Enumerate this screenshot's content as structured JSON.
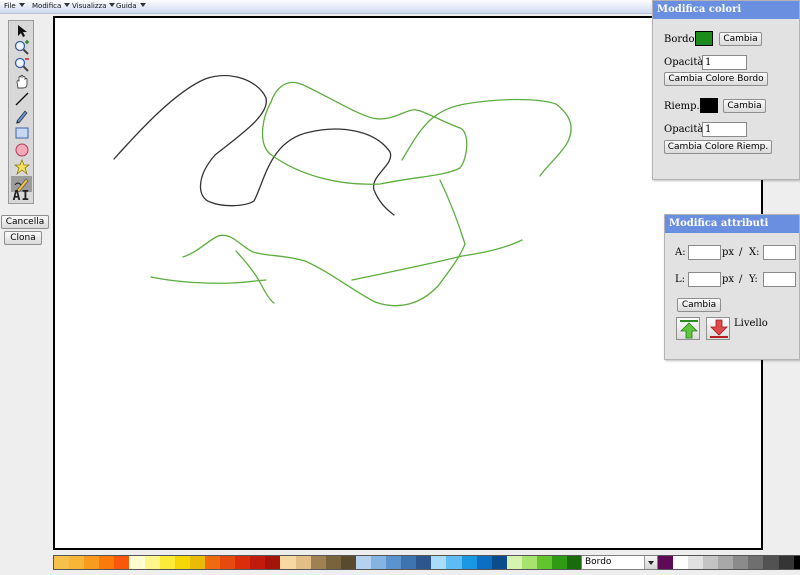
{
  "menu": {
    "items": [
      "File",
      "Modifica",
      "Visualizza",
      "Guida"
    ]
  },
  "toolbox": {
    "tools": [
      "select-arrow-icon",
      "zoom-in-icon",
      "zoom-out-icon",
      "pan-hand-icon",
      "line-icon",
      "pencil-icon",
      "rectangle-icon",
      "ellipse-icon",
      "polygon-star-icon",
      "freehand-icon",
      "text-icon"
    ],
    "active": "freehand-icon",
    "text_tool_label": "AI"
  },
  "actions": {
    "delete_label": "Cancella",
    "clone_label": "Clona"
  },
  "colors_panel": {
    "title": "Modifica colori",
    "border_label": "Bordo:",
    "border_color": "#1d8a1d",
    "change_label": "Cambia",
    "border_opacity_label": "Opacità:",
    "border_opacity_value": "1",
    "change_border_color_label": "Cambia Colore Bordo",
    "fill_label": "Riemp.:",
    "fill_color": "#000000",
    "fill_change_label": "Cambia",
    "fill_opacity_label": "Opacità:",
    "fill_opacity_value": "1",
    "change_fill_color_label": "Cambia Colore Riemp."
  },
  "attributes_panel": {
    "title": "Modifica attributi",
    "a_label": "A:",
    "a_unit": "px",
    "slash1": "/",
    "x_label": "X:",
    "l_label": "L:",
    "l_unit": "px",
    "slash2": "/",
    "y_label": "Y:",
    "change_label": "Cambia",
    "level_label": "Livello"
  },
  "palette": {
    "colors": [
      "#f6c14a",
      "#f7b637",
      "#f99b1f",
      "#fb7a0c",
      "#f9570b",
      "#fefed0",
      "#fef68a",
      "#fdeb3a",
      "#f5d708",
      "#e7bb06",
      "#f06b10",
      "#e64a0f",
      "#d92d0c",
      "#c21b0b",
      "#a31509",
      "#f6d9a2",
      "#e2bd86",
      "#9d8155",
      "#79633d",
      "#5a4a2d",
      "#b4d2ef",
      "#86b4e2",
      "#5b93cc",
      "#3e74b0",
      "#2c568c",
      "#a9dcfa",
      "#5cbdf4",
      "#1a98e4",
      "#0d6fc2",
      "#0a4c8c",
      "#d6f3b0",
      "#a7e36e",
      "#62c52d",
      "#2f9a13",
      "#1a6b0b",
      "#0b4a06",
      "#fcc7e9",
      "#f772d2",
      "#e119b6",
      "#a60f8c",
      "#5e0a57",
      "#ffffff",
      "#e1e1e1",
      "#c4c4c4",
      "#a8a8a8",
      "#8b8b8b",
      "#6f6f6f",
      "#525252",
      "#353535",
      "#000000"
    ],
    "mode_value": "Bordo"
  },
  "canvas": {
    "stroke_colors": {
      "dark": "#333333",
      "green": "#5cae3e"
    }
  }
}
